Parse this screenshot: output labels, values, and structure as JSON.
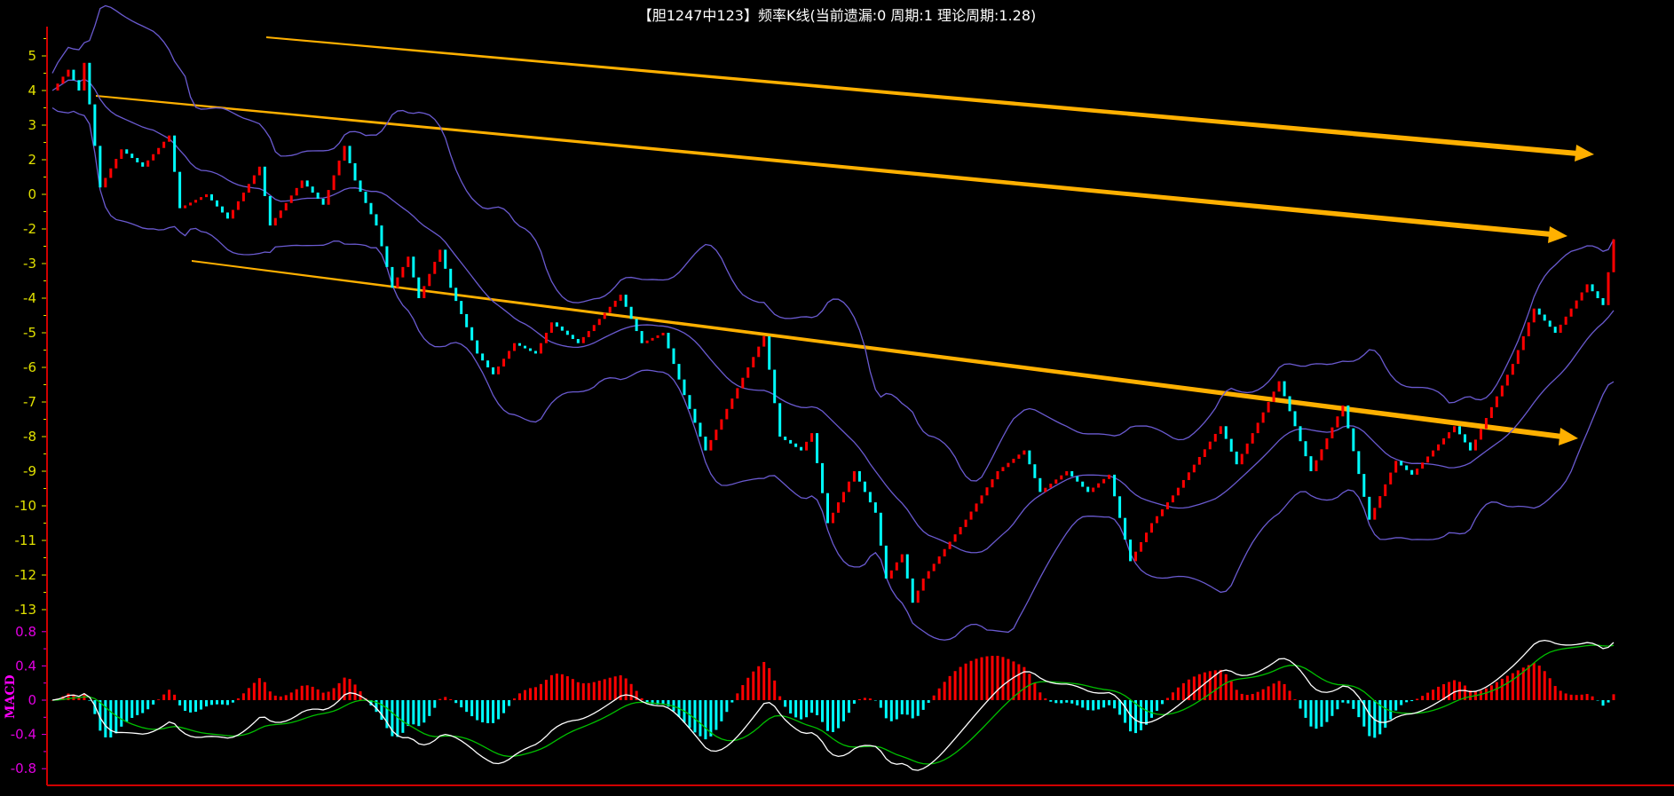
{
  "title": "【胆1247中123】频率K线(当前遗漏:0 周期:1 理论周期:1.28)",
  "colors": {
    "up": "#ff0000",
    "down": "#00ffff",
    "band": "#6a5ad0",
    "axis": "#d00000",
    "trend": "#ffb000",
    "dif": "#ffffff",
    "dea": "#00c000",
    "tick_main": "#e0e000",
    "tick_macd": "#e000e0"
  },
  "chart_data": {
    "type": "candlestick",
    "title": "【胆1247中123】频率K线(当前遗漏:0 周期:1 理论周期:1.28)",
    "y_tick_labels": [
      "5",
      "4",
      "3",
      "2",
      "0",
      "-2",
      "-3",
      "-4",
      "-5",
      "-6",
      "-7",
      "-8",
      "-9",
      "-10",
      "-11",
      "-12",
      "-13"
    ],
    "ylim_index_units": [
      -11,
      5
    ],
    "bar_count": 295,
    "close_waypoints": [
      [
        0,
        4.0
      ],
      [
        3,
        4.6
      ],
      [
        5,
        4.0
      ],
      [
        6,
        4.8
      ],
      [
        9,
        1.2
      ],
      [
        13,
        2.3
      ],
      [
        17,
        1.8
      ],
      [
        22,
        2.7
      ],
      [
        24,
        0.6
      ],
      [
        29,
        1.0
      ],
      [
        33,
        0.3
      ],
      [
        39,
        1.8
      ],
      [
        41,
        0.1
      ],
      [
        47,
        1.4
      ],
      [
        51,
        0.7
      ],
      [
        55,
        2.4
      ],
      [
        57,
        1.4
      ],
      [
        61,
        0.1
      ],
      [
        64,
        -1.7
      ],
      [
        67,
        -0.8
      ],
      [
        69,
        -2.0
      ],
      [
        73,
        -0.6
      ],
      [
        75,
        -1.7
      ],
      [
        80,
        -3.6
      ],
      [
        83,
        -4.2
      ],
      [
        87,
        -3.3
      ],
      [
        91,
        -3.6
      ],
      [
        94,
        -2.7
      ],
      [
        99,
        -3.3
      ],
      [
        107,
        -1.9
      ],
      [
        111,
        -3.3
      ],
      [
        115,
        -3.0
      ],
      [
        119,
        -4.8
      ],
      [
        123,
        -6.4
      ],
      [
        134,
        -3.1
      ],
      [
        137,
        -6.0
      ],
      [
        141,
        -6.4
      ],
      [
        143,
        -5.9
      ],
      [
        146,
        -8.5
      ],
      [
        151,
        -7.0
      ],
      [
        155,
        -8.2
      ],
      [
        157,
        -10.1
      ],
      [
        160,
        -9.4
      ],
      [
        162,
        -10.8
      ],
      [
        164,
        -10.1
      ],
      [
        172,
        -8.4
      ],
      [
        178,
        -7.0
      ],
      [
        183,
        -6.4
      ],
      [
        186,
        -7.6
      ],
      [
        191,
        -7.0
      ],
      [
        195,
        -7.6
      ],
      [
        199,
        -7.1
      ],
      [
        203,
        -9.6
      ],
      [
        207,
        -8.5
      ],
      [
        211,
        -7.7
      ],
      [
        220,
        -5.7
      ],
      [
        223,
        -6.8
      ],
      [
        231,
        -4.4
      ],
      [
        237,
        -7.0
      ],
      [
        243,
        -5.1
      ],
      [
        248,
        -8.4
      ],
      [
        253,
        -6.7
      ],
      [
        256,
        -7.1
      ],
      [
        264,
        -5.7
      ],
      [
        267,
        -6.4
      ],
      [
        275,
        -3.9
      ],
      [
        279,
        -2.3
      ],
      [
        283,
        -3.0
      ],
      [
        289,
        -1.6
      ],
      [
        292,
        -2.2
      ],
      [
        294,
        -0.3
      ]
    ],
    "bollinger": {
      "period": 20,
      "k": 2
    },
    "trend_arrows": 3,
    "macd": {
      "label": "MACD",
      "tick_labels": [
        "0.8",
        "0.4",
        "0",
        "-0.4",
        "-0.8"
      ],
      "tick_values": [
        0.8,
        0.4,
        0,
        -0.4,
        -0.8
      ],
      "ylim": [
        -0.95,
        0.95
      ],
      "fast": 12,
      "slow": 26,
      "signal": 9
    }
  }
}
